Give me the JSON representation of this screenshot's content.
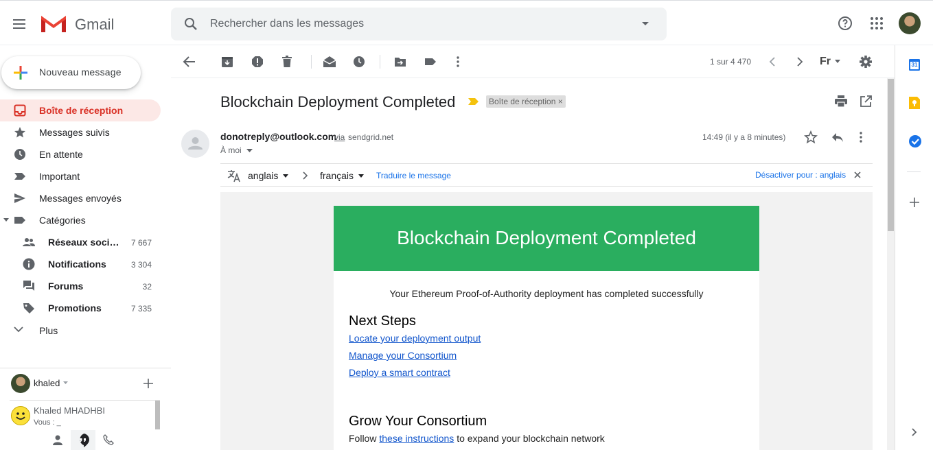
{
  "header": {
    "app_name": "Gmail",
    "search_placeholder": "Rechercher dans les messages"
  },
  "sidebar": {
    "compose_label": "Nouveau message",
    "items": [
      {
        "label": "Boîte de réception",
        "icon": "inbox-icon",
        "active": true
      },
      {
        "label": "Messages suivis",
        "icon": "star-icon"
      },
      {
        "label": "En attente",
        "icon": "clock-icon"
      },
      {
        "label": "Important",
        "icon": "important-icon"
      },
      {
        "label": "Messages envoyés",
        "icon": "send-icon"
      },
      {
        "label": "Catégories",
        "icon": "label-icon"
      }
    ],
    "categories": [
      {
        "label": "Réseaux sociaux",
        "count": "7 667",
        "icon": "people-icon"
      },
      {
        "label": "Notifications",
        "count": "3 304",
        "icon": "info-icon"
      },
      {
        "label": "Forums",
        "count": "32",
        "icon": "forum-icon"
      },
      {
        "label": "Promotions",
        "count": "7 335",
        "icon": "tag-icon"
      }
    ],
    "more_label": "Plus"
  },
  "hangouts": {
    "user": "khaled",
    "contact_name": "Khaled MHADHBI",
    "contact_status": "Vous :   _"
  },
  "toolbar": {
    "pager": "1 sur 4 470",
    "input_tools": "Fr"
  },
  "message": {
    "subject": "Blockchain Deployment Completed",
    "label_chip": "Boîte de réception ×",
    "sender_email": "donotreply@outlook.com",
    "via": "via",
    "via_domain": "sendgrid.net",
    "recipient": "À moi",
    "timestamp": "14:49 (il y a 8 minutes)"
  },
  "translate": {
    "from_lang": "anglais",
    "to_lang": "français",
    "translate_link": "Traduire le message",
    "disable_link": "Désactiver pour : anglais"
  },
  "email_body": {
    "banner_title": "Blockchain Deployment Completed",
    "intro": "Your Ethereum Proof-of-Authority deployment has completed successfully",
    "next_steps_title": "Next Steps",
    "links": [
      "Locate your deployment output",
      "Manage your Consortium",
      "Deploy a smart contract"
    ],
    "grow_title": "Grow Your Consortium",
    "grow_prefix": "Follow",
    "grow_link": "these instructions",
    "grow_suffix": "to expand your blockchain network"
  },
  "right_rail": {
    "calendar_day": "31"
  },
  "colors": {
    "accent_red": "#d93025",
    "active_bg": "#fce8e6",
    "banner_green": "#2aae5f",
    "link_blue": "#1a73e8"
  }
}
